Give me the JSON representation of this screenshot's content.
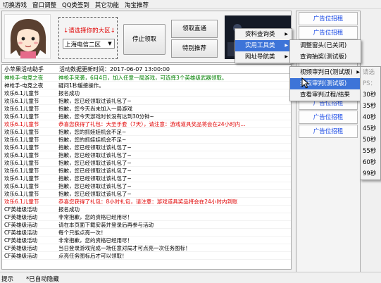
{
  "menubar": [
    "切换游戏",
    "窗口调整",
    "QQ类签到",
    "其它功能",
    "淘宝推荐"
  ],
  "top": {
    "region_label": "↓请选择你的大区↓",
    "region_value": "上海电信二区",
    "stop_button": "停止领取",
    "direct_button": "领取直通",
    "special_button": "特别推荐"
  },
  "log": {
    "head_left": "小苹果活动助手",
    "head_right": "活动数据更新时间：2017-06-07 13:00:00",
    "rows": [
      {
        "a": "神枪手-电竞之夜",
        "b": "神枪手来袭，6月4日，加入任意一局游戏，可选择3个英雄级武器领取。",
        "color": "#008000"
      },
      {
        "a": "神枪手-电竞之夜",
        "b": "疑问1秒缓接操作。",
        "color": "#000000"
      },
      {
        "a": "欢乐6.1儿童节",
        "b": "报名成功",
        "color": "#000000"
      },
      {
        "a": "欢乐6.1儿童节",
        "b": "抱歉，您已经领取过该礼包了~",
        "color": "#000000"
      },
      {
        "a": "欢乐6.1儿童节",
        "b": "抱歉，您今天尚未加入一局游戏",
        "color": "#000000"
      },
      {
        "a": "欢乐6.1儿童节",
        "b": "抱歉，您今天游戏时长没有达到30分钟~",
        "color": "#000000"
      },
      {
        "a": "欢乐6.1儿童节",
        "b": "恭喜您获得了礼包：大圣手套（7天），请注意：游戏道具奖品将会在24小时内…",
        "color": "#e00000"
      },
      {
        "a": "欢乐6.1儿童节",
        "b": "抱歉，您的抓娃娃机会不足~",
        "color": "#000000"
      },
      {
        "a": "欢乐6.1儿童节",
        "b": "抱歉，您的抓娃娃机会不足~",
        "color": "#000000"
      },
      {
        "a": "欢乐6.1儿童节",
        "b": "抱歉，您已经领取过该礼包了~",
        "color": "#000000"
      },
      {
        "a": "欢乐6.1儿童节",
        "b": "抱歉，您已经领取过该礼包了~",
        "color": "#000000"
      },
      {
        "a": "欢乐6.1儿童节",
        "b": "抱歉，您已经领取过该礼包了~",
        "color": "#000000"
      },
      {
        "a": "欢乐6.1儿童节",
        "b": "抱歉，您已经领取过该礼包了~",
        "color": "#000000"
      },
      {
        "a": "欢乐6.1儿童节",
        "b": "抱歉，您已经领取过该礼包了~",
        "color": "#000000"
      },
      {
        "a": "欢乐6.1儿童节",
        "b": "抱歉，您已经领取过该礼包了~",
        "color": "#000000"
      },
      {
        "a": "欢乐6.1儿童节",
        "b": "抱歉，您已经领取过该礼包了~",
        "color": "#000000"
      },
      {
        "a": "欢乐6.1儿童节",
        "b": "恭喜您获得了礼包：8小时礼包，请注意：游戏道具奖品将会在24小时内到账",
        "color": "#e00000"
      },
      {
        "a": "CF英雄级活动",
        "b": "报名成功",
        "color": "#000000"
      },
      {
        "a": "CF英雄级活动",
        "b": "非常抱歉，您的资格已经用尽！",
        "color": "#000000"
      },
      {
        "a": "CF英雄级活动",
        "b": "请在本页面下载安装并登录后再参与活动",
        "color": "#000000"
      },
      {
        "a": "CF英雄级活动",
        "b": "每个只能点亮一次！",
        "color": "#000000"
      },
      {
        "a": "CF英雄级活动",
        "b": "非常抱歉，您的资格已经用尽！",
        "color": "#000000"
      },
      {
        "a": "CF英雄级活动",
        "b": "当日登录游戏完成一场任意对局才可点亮一次任务图标！",
        "color": "#000000"
      },
      {
        "a": "CF英雄级活动",
        "b": "点亮任务图标后才可以领取！",
        "color": "#000000"
      }
    ]
  },
  "ads": [
    "广告位招租",
    "广告位招租",
    "广告位招租",
    "广告位招租",
    "广告位招租",
    "广告位招租",
    "广告位招租",
    "广告位招租",
    "广告位招租"
  ],
  "status": {
    "a": "提示",
    "b": "*已自动隐藏"
  },
  "menus": {
    "m1": [
      "资料查询类",
      "实用工具类",
      "网址导航类"
    ],
    "m2": [
      "调整窗头(已关闭)",
      "查询抽奖(测试版)"
    ],
    "m3": [
      "视频审判日(测试版)",
      "搜索审判(测试版)",
      "查看审判过程/结果"
    ],
    "m4": [
      "请选",
      "PS：",
      "30秒",
      "35秒",
      "40秒",
      "45秒",
      "50秒",
      "55秒",
      "60秒",
      "99秒"
    ]
  }
}
